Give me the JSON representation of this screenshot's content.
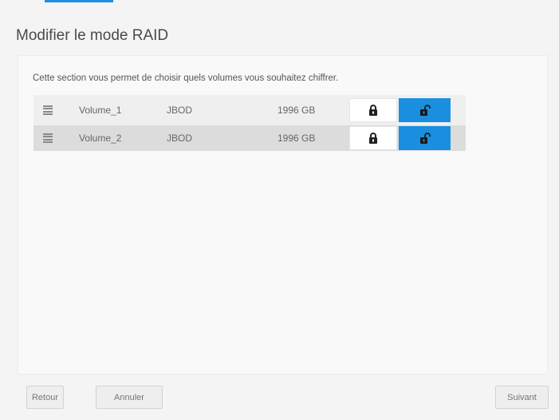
{
  "page": {
    "title": "Modifier le mode RAID",
    "description": "Cette section vous permet de choisir quels volumes vous souhaitez chiffrer."
  },
  "volumes": [
    {
      "name": "Volume_1",
      "type": "JBOD",
      "size": "1996 GB",
      "encryption": "unlocked"
    },
    {
      "name": "Volume_2",
      "type": "JBOD",
      "size": "1996 GB",
      "encryption": "unlocked"
    }
  ],
  "icons": {
    "drag": "drag-handle-icon",
    "lock": "lock-icon",
    "unlock": "unlock-icon"
  },
  "footer": {
    "back_label": "Retour",
    "cancel_label": "Annuler",
    "next_label": "Suivant"
  },
  "colors": {
    "accent": "#1a8fe0",
    "background": "#f4f4f4"
  }
}
